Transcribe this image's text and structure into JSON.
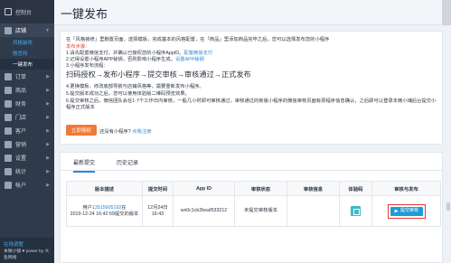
{
  "sidebar": {
    "dashboard": "控制台",
    "store": "店铺",
    "store_sub": [
      "风格装修",
      "微官网",
      "一键发布"
    ],
    "items": [
      "订单",
      "商品",
      "财务",
      "门店",
      "客户",
      "营销",
      "设置",
      "统计",
      "帐户"
    ],
    "bottom_link": "在线调整",
    "bottom_text": "本微小铺 ♥ power by 大鱼网络"
  },
  "header": {
    "title": "一键发布"
  },
  "info": {
    "line1": "在「风格装修」里删置页面，选择模板，完成基本的风格配置，在「商品」里添加商品完毕之后，您可以选择发布您的小程序",
    "process_label": "发布步骤：",
    "step1_pre": "1.请先配置微信支付，并确认已授权您的小程序AppID。",
    "step1_link": "配置微信支付",
    "step2_pre": "2.记得设置小程序APP秘钥，否则影响小程序生成，",
    "step2_link": "设置APP秘钥",
    "step3": "3.小程序发布流程：",
    "flow": "扫码授权→发布小程序→提交审核→审核通过→正式发布",
    "note4": "4.更换模板、修改底部导航与店铺风格等，需要重新发布小程序。",
    "note5": "5.提交版本成功之后，您可以使用体验版二维码预览效果。",
    "note6": "6.提交审核之后，微信团队会在1-7个工作日内审核，一般几小时即可审核通过，审核通过的新版小程序的微信审核页面有原程序信息确认，之后即可以登录本微小铺后台提交小程序正式版本",
    "button": "立即授权",
    "no_app_pre": "还没有小程序?",
    "no_app_link": "点我注册"
  },
  "tabs": [
    "最新提交",
    "历史记录"
  ],
  "table": {
    "headers": [
      "版本描述",
      "提交时间",
      "App ID",
      "审核状态",
      "审核信息",
      "体验码",
      "审核与发布"
    ],
    "row": {
      "desc_pre": "用户",
      "desc_user": "13515605192",
      "desc_mid": "在",
      "desc_time": "2019-12-24 16:42:59",
      "desc_post": "提交的版本",
      "time": "12月24日 16:43",
      "appid": "wx0c1cb2beaf533212",
      "status": "未提交审核版本",
      "info": "",
      "submit": "提交审核"
    }
  },
  "colors": {
    "sidebar": "#2f3a4a",
    "accent_blue": "#2b88d8",
    "orange_button": "#ee7a3a",
    "highlight_red": "#e53935"
  }
}
